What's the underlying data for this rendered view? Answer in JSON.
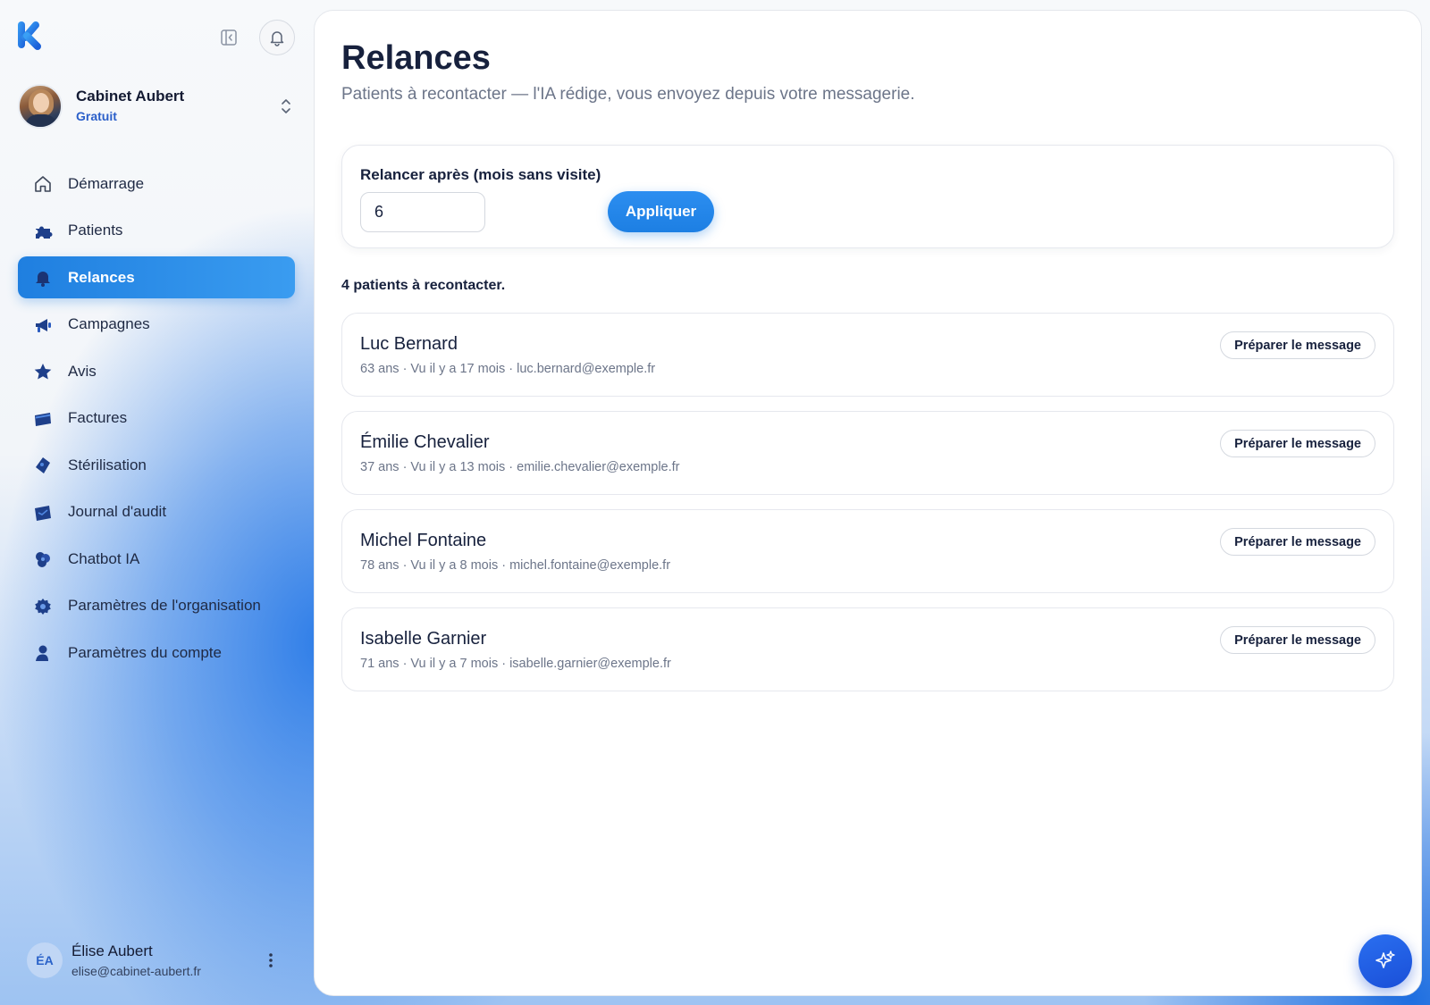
{
  "sidebar": {
    "org": {
      "name": "Cabinet Aubert",
      "plan": "Gratuit"
    },
    "items": [
      {
        "label": "Démarrage",
        "icon": "home-icon"
      },
      {
        "label": "Patients",
        "icon": "puzzle-icon"
      },
      {
        "label": "Relances",
        "icon": "bell-icon",
        "active": true
      },
      {
        "label": "Campagnes",
        "icon": "megaphone-icon"
      },
      {
        "label": "Avis",
        "icon": "star-icon"
      },
      {
        "label": "Factures",
        "icon": "invoice-icon"
      },
      {
        "label": "Stérilisation",
        "icon": "shield-icon"
      },
      {
        "label": "Journal d'audit",
        "icon": "journal-icon"
      },
      {
        "label": "Chatbot IA",
        "icon": "chatbot-icon"
      },
      {
        "label": "Paramètres de l'organisation",
        "icon": "gear-icon"
      },
      {
        "label": "Paramètres du compte",
        "icon": "user-icon"
      }
    ],
    "user": {
      "initials": "ÉA",
      "name": "Élise Aubert",
      "email": "elise@cabinet-aubert.fr"
    }
  },
  "main": {
    "title": "Relances",
    "subtitle": "Patients à recontacter — l'IA rédige, vous envoyez depuis votre messagerie.",
    "filter": {
      "label": "Relancer après (mois sans visite)",
      "value": "6",
      "apply_label": "Appliquer"
    },
    "count_text": "4 patients à recontacter.",
    "patients": [
      {
        "name": "Luc Bernard",
        "meta": "63 ans · Vu il y a 17 mois · luc.bernard@exemple.fr",
        "action": "Préparer le message"
      },
      {
        "name": "Émilie Chevalier",
        "meta": "37 ans · Vu il y a 13 mois · emilie.chevalier@exemple.fr",
        "action": "Préparer le message"
      },
      {
        "name": "Michel Fontaine",
        "meta": "78 ans · Vu il y a 8 mois · michel.fontaine@exemple.fr",
        "action": "Préparer le message"
      },
      {
        "name": "Isabelle Garnier",
        "meta": "71 ans · Vu il y a 7 mois · isabelle.garnier@exemple.fr",
        "action": "Préparer le message"
      }
    ]
  },
  "colors": {
    "accent": "#1f7fe0",
    "brand": "#1a4fd8",
    "text": "#17213d",
    "muted": "#6c7589"
  }
}
